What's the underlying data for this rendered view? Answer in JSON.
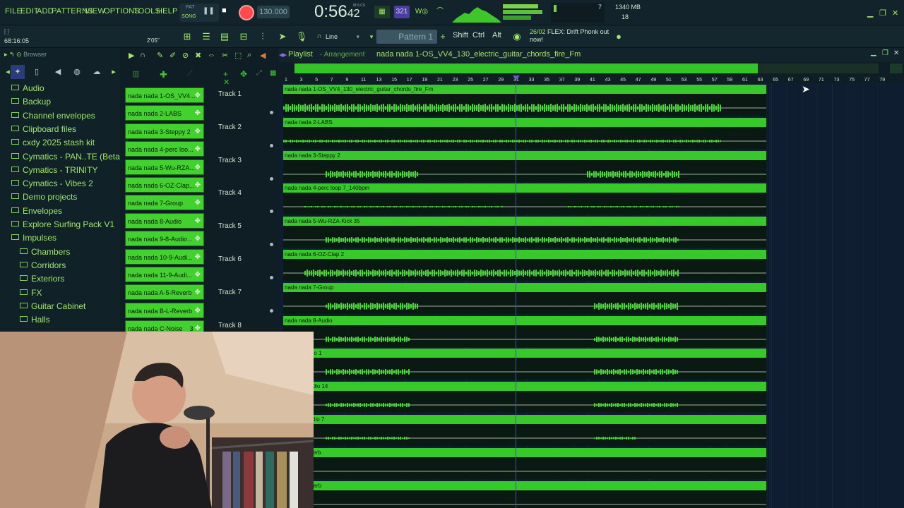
{
  "menu": {
    "file": "FILE",
    "edit": "EDIT",
    "add": "ADD",
    "patterns": "PATTERNS",
    "view": "VIEW",
    "options": "OPTIONS",
    "tools": "TOOLS",
    "help": "HELP"
  },
  "transport": {
    "pat_label": "PAT",
    "song_label": "SONG",
    "tempo": "130.000",
    "time": "0:56",
    "time_sub": "42",
    "time_unit": "M:S:CS"
  },
  "monitor": {
    "voices": "7",
    "memory": "1340 MB",
    "polyphony": "18"
  },
  "toolbar2": {
    "cursor_bracket": "[   ]",
    "cursor_pos": "68:16:05",
    "time_sig": "2'05\"",
    "snap": "Line",
    "pattern": "Pattern 1",
    "shift": "Shift",
    "ctrl": "Ctrl",
    "alt": "Alt",
    "news_date": "26/02",
    "news_text": "FLEX: Drift Phonk out now!"
  },
  "browser": {
    "title": "Browser",
    "items": [
      {
        "label": "Audio",
        "indent": 0
      },
      {
        "label": "Backup",
        "indent": 0
      },
      {
        "label": "Channel envelopes",
        "indent": 0
      },
      {
        "label": "Clipboard files",
        "indent": 0
      },
      {
        "label": "cxdy 2025 stash kit",
        "indent": 0
      },
      {
        "label": "Cymatics - PAN..TE (Beta Pack)",
        "indent": 0
      },
      {
        "label": "Cymatics - TRINITY",
        "indent": 0
      },
      {
        "label": "Cymatics - Vibes 2",
        "indent": 0
      },
      {
        "label": "Demo projects",
        "indent": 0
      },
      {
        "label": "Envelopes",
        "indent": 0
      },
      {
        "label": "Explore Surfing Pack V1",
        "indent": 0
      },
      {
        "label": "Impulses",
        "indent": 0
      },
      {
        "label": "Chambers",
        "indent": 1
      },
      {
        "label": "Corridors",
        "indent": 1
      },
      {
        "label": "Exteriors",
        "indent": 1
      },
      {
        "label": "FX",
        "indent": 1
      },
      {
        "label": "Guitar Cabinet",
        "indent": 1
      },
      {
        "label": "Halls",
        "indent": 1
      }
    ]
  },
  "channels": [
    "nada nada 1-OS_VV4...",
    "nada nada 2-LABS",
    "nada nada 3-Steppy 2",
    "nada nada 4-perc loo...",
    "nada nada 5-Wu-RZA...",
    "nada nada 6-OZ-Clap...",
    "nada nada 7-Group",
    "nada nada 8-Audio",
    "nada nada 9-8-Audio...",
    "nada nada 10-9-Audi...",
    "nada nada 11-9-Audi...",
    "nada nada A-5-Reverb",
    "nada nada B-L-Reverb",
    "nada nada C-Noise__3"
  ],
  "playlist": {
    "title": "Playlist",
    "subtitle": "Arrangement",
    "song": "nada nada 1-OS_VV4_130_electric_guitar_chords_fire_Fm",
    "ruler": [
      "1",
      "3",
      "5",
      "7",
      "9",
      "11",
      "13",
      "15",
      "17",
      "19",
      "21",
      "23",
      "25",
      "27",
      "29",
      "31",
      "33",
      "35",
      "37",
      "39",
      "41",
      "43",
      "45",
      "47",
      "49",
      "51",
      "53",
      "55",
      "57",
      "59",
      "61",
      "63",
      "65",
      "67",
      "69",
      "71",
      "73",
      "75",
      "77",
      "79"
    ],
    "tracks": [
      {
        "label": "Track 1",
        "clip": "nada nada 1-OS_VV4_130_electric_guitar_chords_fire_Fm"
      },
      {
        "label": "Track 2",
        "clip": "nada nada 2-LABS"
      },
      {
        "label": "Track 3",
        "clip": "nada nada 3-Steppy 2"
      },
      {
        "label": "Track 4",
        "clip": "nada nada 4-perc loop 7_140bpm"
      },
      {
        "label": "Track 5",
        "clip": "nada nada 5-Wu-RZA-Kick 35"
      },
      {
        "label": "Track 6",
        "clip": "nada nada 6-OZ-Clap 2"
      },
      {
        "label": "Track 7",
        "clip": "nada nada 7-Group"
      },
      {
        "label": "Track 8",
        "clip": "nada nada 8-Audio"
      },
      {
        "label": "",
        "clip": "da 9-8-Audio 1"
      },
      {
        "label": "",
        "clip": "da 10-9-Audio 14"
      },
      {
        "label": "",
        "clip": "da 11-9-Audio 7"
      },
      {
        "label": "",
        "clip": "da A-5-Reverb"
      },
      {
        "label": "",
        "clip": "da B-L-Reverb"
      }
    ]
  },
  "colors": {
    "accent_green": "#37c829",
    "menu_green": "#9fe86a",
    "record_red": "#ff4b4b",
    "lane_bg": "#0f1d31"
  }
}
